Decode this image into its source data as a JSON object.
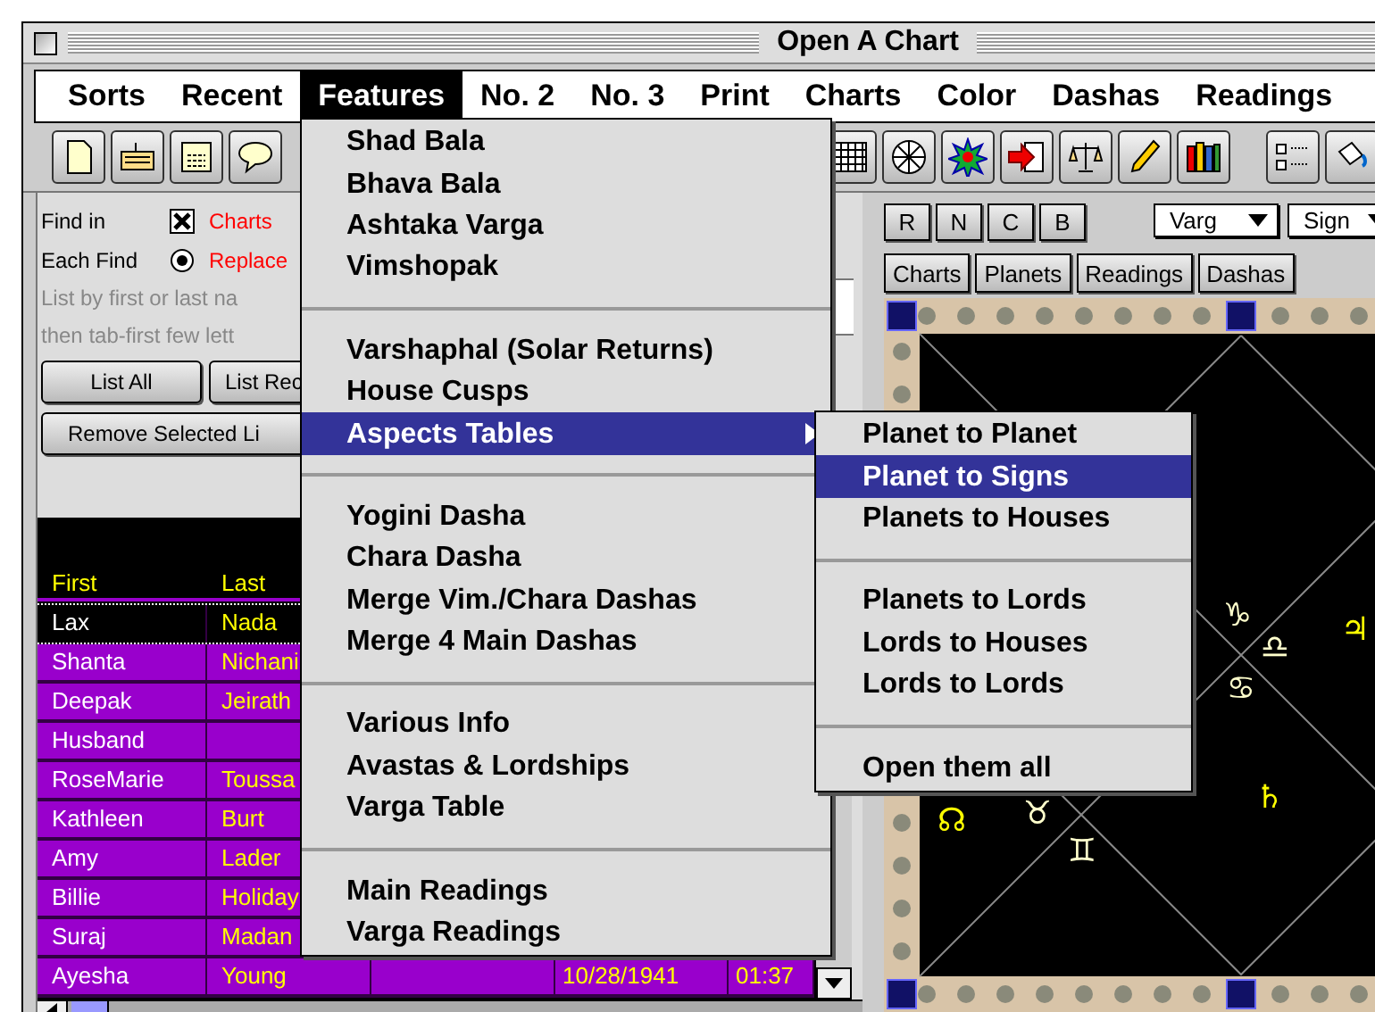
{
  "window": {
    "title": "Open A Chart"
  },
  "menu_bar": [
    {
      "label": "Sorts",
      "selected": false
    },
    {
      "label": "Recent",
      "selected": false
    },
    {
      "label": "Features",
      "selected": true
    },
    {
      "label": "No. 2",
      "selected": false
    },
    {
      "label": "No. 3",
      "selected": false
    },
    {
      "label": "Print",
      "selected": false
    },
    {
      "label": "Charts",
      "selected": false
    },
    {
      "label": "Color",
      "selected": false
    },
    {
      "label": "Dashas",
      "selected": false
    },
    {
      "label": "Readings",
      "selected": false
    }
  ],
  "find": {
    "find_in_label": "Find in",
    "find_in_checked": true,
    "find_in_option": "Charts",
    "each_find_label": "Each Find",
    "each_find_selected": true,
    "each_find_option": "Replace",
    "hint_lines": [
      "List by first or last na",
      "then tab-first few lett"
    ]
  },
  "buttons": [
    "List All",
    "List Rec"
  ],
  "wide_button": "Remove Selected Li",
  "table": {
    "columns": [
      "First",
      "Last"
    ],
    "rows": [
      {
        "first": "Lax",
        "last": "Nada",
        "selected": true
      },
      {
        "first": "Shanta",
        "last": "Nichani",
        "selected": false
      },
      {
        "first": "Deepak",
        "last": "Jeirath",
        "selected": false
      },
      {
        "first": "Husband",
        "selected": false
      },
      {
        "first": "RoseMarie",
        "last": "Toussa",
        "selected": false
      },
      {
        "first": "Kathleen",
        "last": "Burt",
        "selected": false
      },
      {
        "first": "Amy",
        "last": "Lader",
        "selected": false
      },
      {
        "first": "Billie",
        "last": "Holiday",
        "selected": false
      },
      {
        "first": "Suraj",
        "last": "Madan",
        "selected": false
      },
      {
        "first": "Ayesha",
        "last": "Young",
        "column_3": "10/28/1941",
        "column_4": "01:37",
        "selected": false
      }
    ]
  },
  "chart_controls": {
    "buttons": [
      "R",
      "N",
      "C",
      "B"
    ],
    "dropdowns": [
      "Varg",
      "Sign"
    ],
    "tabs": [
      "Charts",
      "Planets",
      "Readings",
      "Dashas"
    ]
  },
  "chart": {
    "glyphs": [
      {
        "text": "♑",
        "kind": "sign"
      },
      {
        "text": "♎",
        "kind": "sign"
      },
      {
        "text": "♋",
        "kind": "sign"
      },
      {
        "text": "♃",
        "kind": "planet"
      },
      {
        "text": "♄",
        "kind": "planet"
      },
      {
        "text": "☊",
        "kind": "planet"
      },
      {
        "text": "♉",
        "kind": "sign"
      },
      {
        "text": "♊",
        "kind": "sign"
      }
    ]
  },
  "features_menu": {
    "sections": [
      {
        "items": [
          {
            "label": "Shad Bala",
            "selected": false
          },
          {
            "label": "Bhava Bala",
            "selected": false
          },
          {
            "label": "Ashtaka Varga",
            "selected": false
          },
          {
            "label": "Vimshopak",
            "selected": false
          }
        ]
      },
      {
        "items": [
          {
            "label": "Varshaphal (Solar Returns)",
            "selected": false
          },
          {
            "label": "House Cusps",
            "selected": false
          },
          {
            "label": "Aspects Tables",
            "selected": true,
            "submenu": true
          }
        ]
      },
      {
        "items": [
          {
            "label": "Yogini Dasha",
            "selected": false
          },
          {
            "label": "Chara Dasha",
            "selected": false
          },
          {
            "label": "Merge Vim./Chara Dashas",
            "selected": false
          },
          {
            "label": "Merge 4 Main Dashas",
            "selected": false
          }
        ]
      },
      {
        "items": [
          {
            "label": "Various Info",
            "selected": false
          },
          {
            "label": "Avastas & Lordships",
            "selected": false
          },
          {
            "label": "Varga Table",
            "selected": false
          }
        ]
      },
      {
        "items": [
          {
            "label": "Main Readings",
            "selected": false
          },
          {
            "label": "Varga Readings",
            "selected": false
          }
        ]
      }
    ]
  },
  "submenu": {
    "sections": [
      {
        "items": [
          {
            "label": "Planet to Planet",
            "selected": false
          },
          {
            "label": "Planet to Signs",
            "selected": true
          },
          {
            "label": "Planets to Houses",
            "selected": false
          }
        ]
      },
      {
        "items": [
          {
            "label": "Planets to Lords",
            "selected": false
          },
          {
            "label": "Lords to Houses",
            "selected": false
          },
          {
            "label": "Lords to Lords",
            "selected": false
          }
        ]
      },
      {
        "items": [
          {
            "label": "Open them all",
            "selected": false
          }
        ]
      }
    ]
  }
}
